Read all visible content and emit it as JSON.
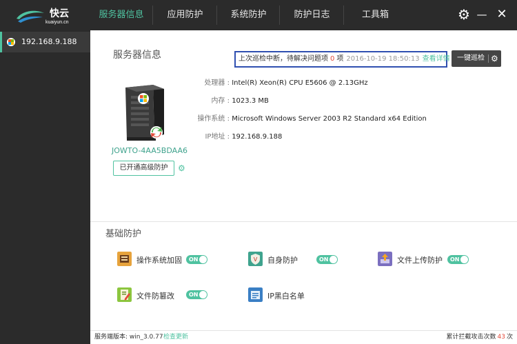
{
  "app": {
    "logo_name": "快云",
    "logo_domain": "kuaiyun.cn"
  },
  "nav": {
    "tabs": [
      {
        "label": "服务器信息",
        "active": true
      },
      {
        "label": "应用防护",
        "active": false
      },
      {
        "label": "系统防护",
        "active": false
      },
      {
        "label": "防护日志",
        "active": false
      },
      {
        "label": "工具箱",
        "active": false
      }
    ]
  },
  "window_controls": {
    "settings_icon": "gear-icon",
    "minimize_glyph": "—",
    "close_glyph": "✕"
  },
  "sidebar": {
    "servers": [
      {
        "label": "192.168.9.188",
        "icon": "windows-icon"
      }
    ]
  },
  "server_info": {
    "title": "服务器信息",
    "alert": {
      "text": "上次巡检中断，待解决问题项",
      "count": "0",
      "unit": "项",
      "time": "2016-10-19 18:50:13",
      "link": "查看详情"
    },
    "scan_button": "一键巡检",
    "hostname": "JOWTO-4AA5BDAA6",
    "advanced_button": "已开通高级防护",
    "rows": [
      {
        "label": "处理器 :",
        "value": "Intel(R) Xeon(R) CPU      E5606 @ 2.13GHz"
      },
      {
        "label": "内存 :",
        "value": "1023.3 MB"
      },
      {
        "label": "操作系统 :",
        "value": "Microsoft Windows Server 2003 R2 Standard x64 Edition"
      },
      {
        "label": "IP地址 :",
        "value": "192.168.9.188"
      }
    ]
  },
  "basic_protection": {
    "title": "基础防护",
    "features": [
      {
        "label": "操作系统加固",
        "toggle": "ON",
        "icon": "os-harden-icon",
        "color": "#e7a33c"
      },
      {
        "label": "自身防护",
        "toggle": "ON",
        "icon": "shield-icon",
        "color": "#3fa38e"
      },
      {
        "label": "文件上传防护",
        "toggle": "ON",
        "icon": "upload-icon",
        "color": "#7b6fbf"
      },
      {
        "label": "文件防篡改",
        "toggle": "ON",
        "icon": "file-edit-icon",
        "color": "#8cc63f"
      },
      {
        "label": "IP黑白名单",
        "icon": "ip-list-icon",
        "color": "#3a7fc4"
      }
    ]
  },
  "status": {
    "version_label": "服务端版本: win_3.0.77",
    "update_link": "检查更新",
    "intercept_label": "累计拦截攻击次数",
    "intercept_count": "43",
    "intercept_unit": "次"
  }
}
